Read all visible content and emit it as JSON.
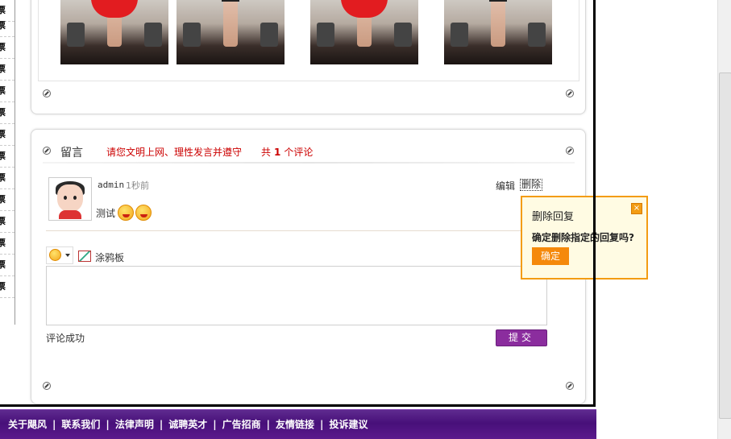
{
  "left_strip": {
    "items": [
      "票",
      "票",
      "票",
      "票",
      "票",
      "票",
      "票",
      "票",
      "票",
      "票",
      "票",
      "票",
      "票",
      "票"
    ]
  },
  "photos": [
    "photo-1",
    "photo-2",
    "photo-3",
    "photo-4"
  ],
  "comments_panel": {
    "title": "留言",
    "notice": "请您文明上网、理性发言并遵守",
    "count_prefix": "共",
    "count": "1",
    "count_suffix": "个评论"
  },
  "comment": {
    "user": "admin",
    "time": "1秒前",
    "text": "测试",
    "edit_label": "编辑",
    "delete_label": "删除",
    "emojis": [
      "grin-emoji-icon",
      "kiss-emoji-icon"
    ]
  },
  "editor": {
    "doodle_label": "涂鸦板",
    "textarea_value": "",
    "status": "评论成功",
    "submit_label": "提交"
  },
  "popup": {
    "title": "删除回复",
    "message": "确定删除指定的回复吗?",
    "confirm_label": "确定",
    "close_symbol": "×"
  },
  "footer": {
    "links": [
      "关于飓风",
      "联系我们",
      "法律声明",
      "诚聘英才",
      "广告招商",
      "友情链接",
      "投诉建议"
    ]
  },
  "colors": {
    "footer_purple": "#5a1a8c",
    "submit_purple": "#8b2d9e",
    "popup_orange": "#f39c12",
    "notice_red": "#cc0000"
  }
}
